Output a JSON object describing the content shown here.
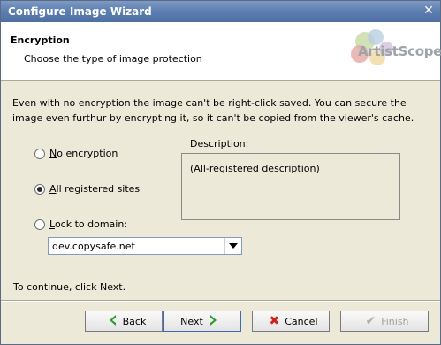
{
  "window": {
    "title": "Configure Image Wizard"
  },
  "header": {
    "title": "Encryption",
    "subtitle": "Choose the type of image protection",
    "logo_text": "ArtistScope"
  },
  "intro_text": "Even with no encryption the image can't be right-click saved. You can secure the image even furthur by encrypting it, so it can't be copied from the viewer's cache.",
  "options": [
    {
      "key": "N",
      "rest": "o encryption",
      "checked": false
    },
    {
      "key": "A",
      "rest": "ll registered sites",
      "checked": true
    },
    {
      "key": "L",
      "rest": "ock to domain:",
      "checked": false
    }
  ],
  "description": {
    "label": "Description:",
    "text": "(All-registered description)"
  },
  "domain_combo": {
    "value": "dev.copysafe.net"
  },
  "continue_text": "To continue, click Next.",
  "buttons": {
    "back": "Back",
    "next": "Next",
    "cancel": "Cancel",
    "finish": "Finish"
  },
  "colors": {
    "titlebar": "#5d7fb1",
    "next_border": "#3e6cb4"
  },
  "icons": {
    "back": "green-left-arrow-icon",
    "next": "green-right-arrow-icon",
    "cancel": "red-x-icon",
    "finish": "check-icon"
  }
}
